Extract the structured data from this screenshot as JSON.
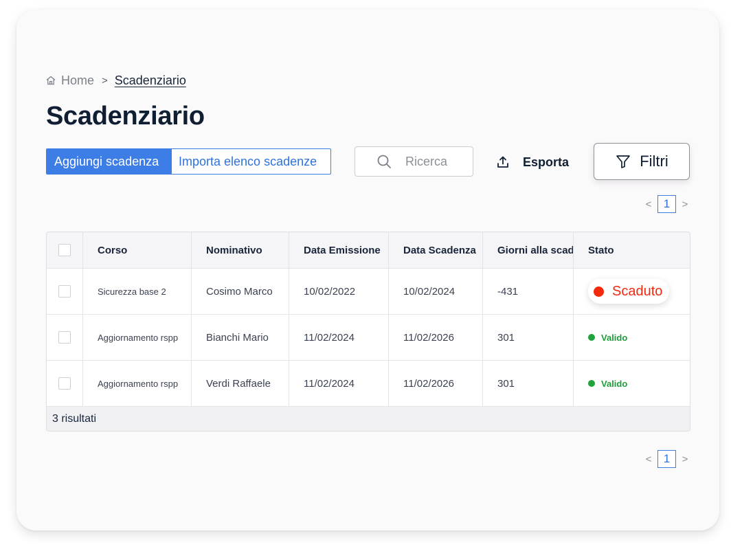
{
  "breadcrumb": {
    "home": "Home",
    "separator": ">",
    "current": "Scadenziario"
  },
  "page_title": "Scadenziario",
  "actions": {
    "add_label": "Aggiungi scadenza",
    "import_label": "Importa elenco scadenze",
    "search_placeholder": "Ricerca",
    "export_label": "Esporta",
    "filters_label": "Filtri"
  },
  "pagination": {
    "prev": "<",
    "current": "1",
    "next": ">"
  },
  "table": {
    "columns": [
      "Corso",
      "Nominativo",
      "Data Emissione",
      "Data Scadenza",
      "Giorni alla scadenza",
      "Stato"
    ],
    "rows": [
      {
        "corso": "Sicurezza base 2",
        "nominativo": "Cosimo Marco",
        "emissione": "10/02/2022",
        "scadenza": "10/02/2024",
        "giorni": "-431",
        "stato": "Scaduto"
      },
      {
        "corso": "Aggiornamento rspp",
        "nominativo": "Bianchi Mario",
        "emissione": "11/02/2024",
        "scadenza": "11/02/2026",
        "giorni": "301",
        "stato": "Valido"
      },
      {
        "corso": "Aggiornamento rspp",
        "nominativo": "Verdi Raffaele",
        "emissione": "11/02/2024",
        "scadenza": "11/02/2026",
        "giorni": "301",
        "stato": "Valido"
      }
    ],
    "results_label": "3 risultati"
  },
  "colors": {
    "primary": "#3d7de6",
    "expired": "#f5290c",
    "valid": "#1fa33c",
    "title": "#0f1e33"
  }
}
